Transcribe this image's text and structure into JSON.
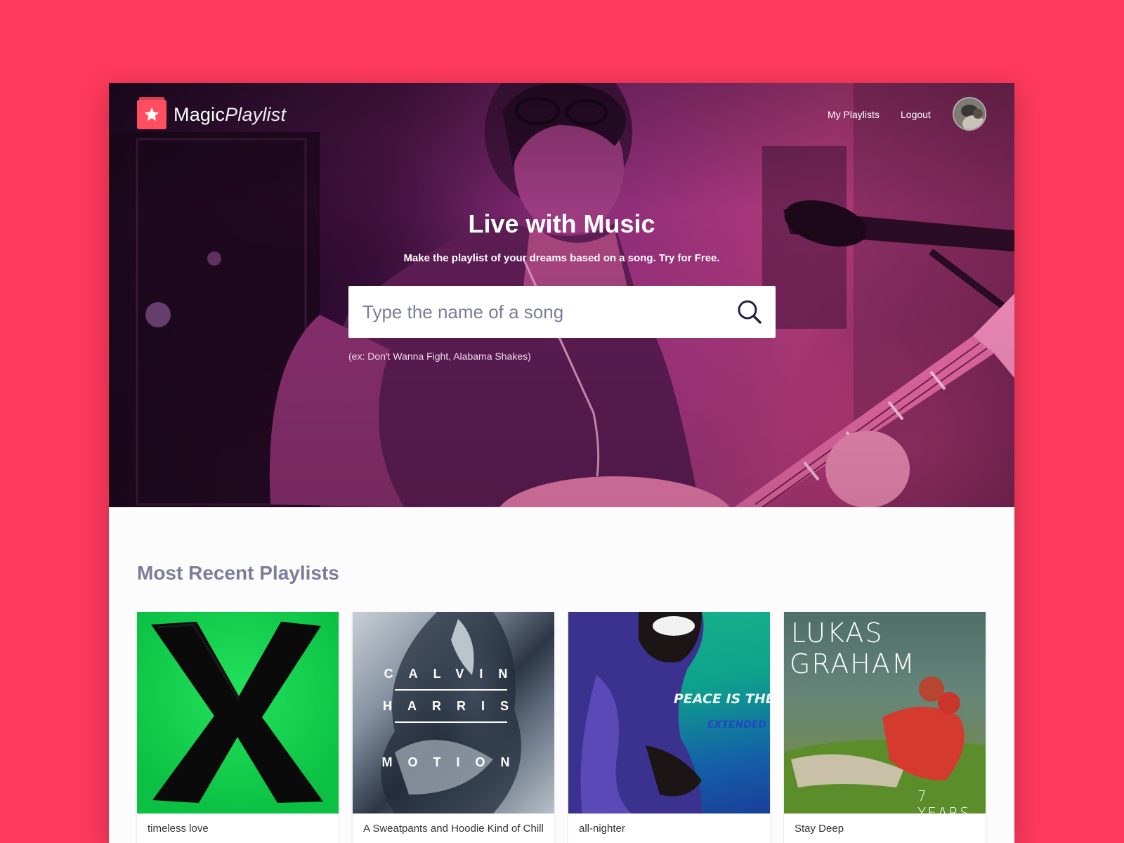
{
  "brand": {
    "name_main": "Magic",
    "name_italic": "Playlist",
    "logo_icon": "star-icon"
  },
  "nav": {
    "my_playlists": "My Playlists",
    "logout": "Logout"
  },
  "hero": {
    "title": "Live with Music",
    "subtitle": "Make the playlist of your dreams based on a song. Try for Free.",
    "search_placeholder": "Type the name of a song",
    "search_icon": "search-icon",
    "example": "(ex: Don't Wanna Fight, Alabama Shakes)"
  },
  "recent": {
    "title": "Most Recent Playlists",
    "playlists": [
      {
        "name": "timeless love"
      },
      {
        "name": "A Sweatpants and Hoodie Kind of Chill"
      },
      {
        "name": "all-nighter",
        "cover_title": "PEACE IS THE MISSION",
        "cover_subtitle": "EXTENDED"
      },
      {
        "name": "Stay Deep",
        "cover_line1": "LUKAS",
        "cover_line2": "GRAHAM",
        "cover_caption": "7 YEARS"
      }
    ],
    "cover2_lines": [
      "CALVIN",
      "HARRIS",
      "MOTION"
    ]
  },
  "colors": {
    "page_background": "#ff3a5e",
    "brand_red": "#ff4e5f",
    "muted_heading": "#7d7c9b",
    "search_icon": "#1f2347"
  }
}
